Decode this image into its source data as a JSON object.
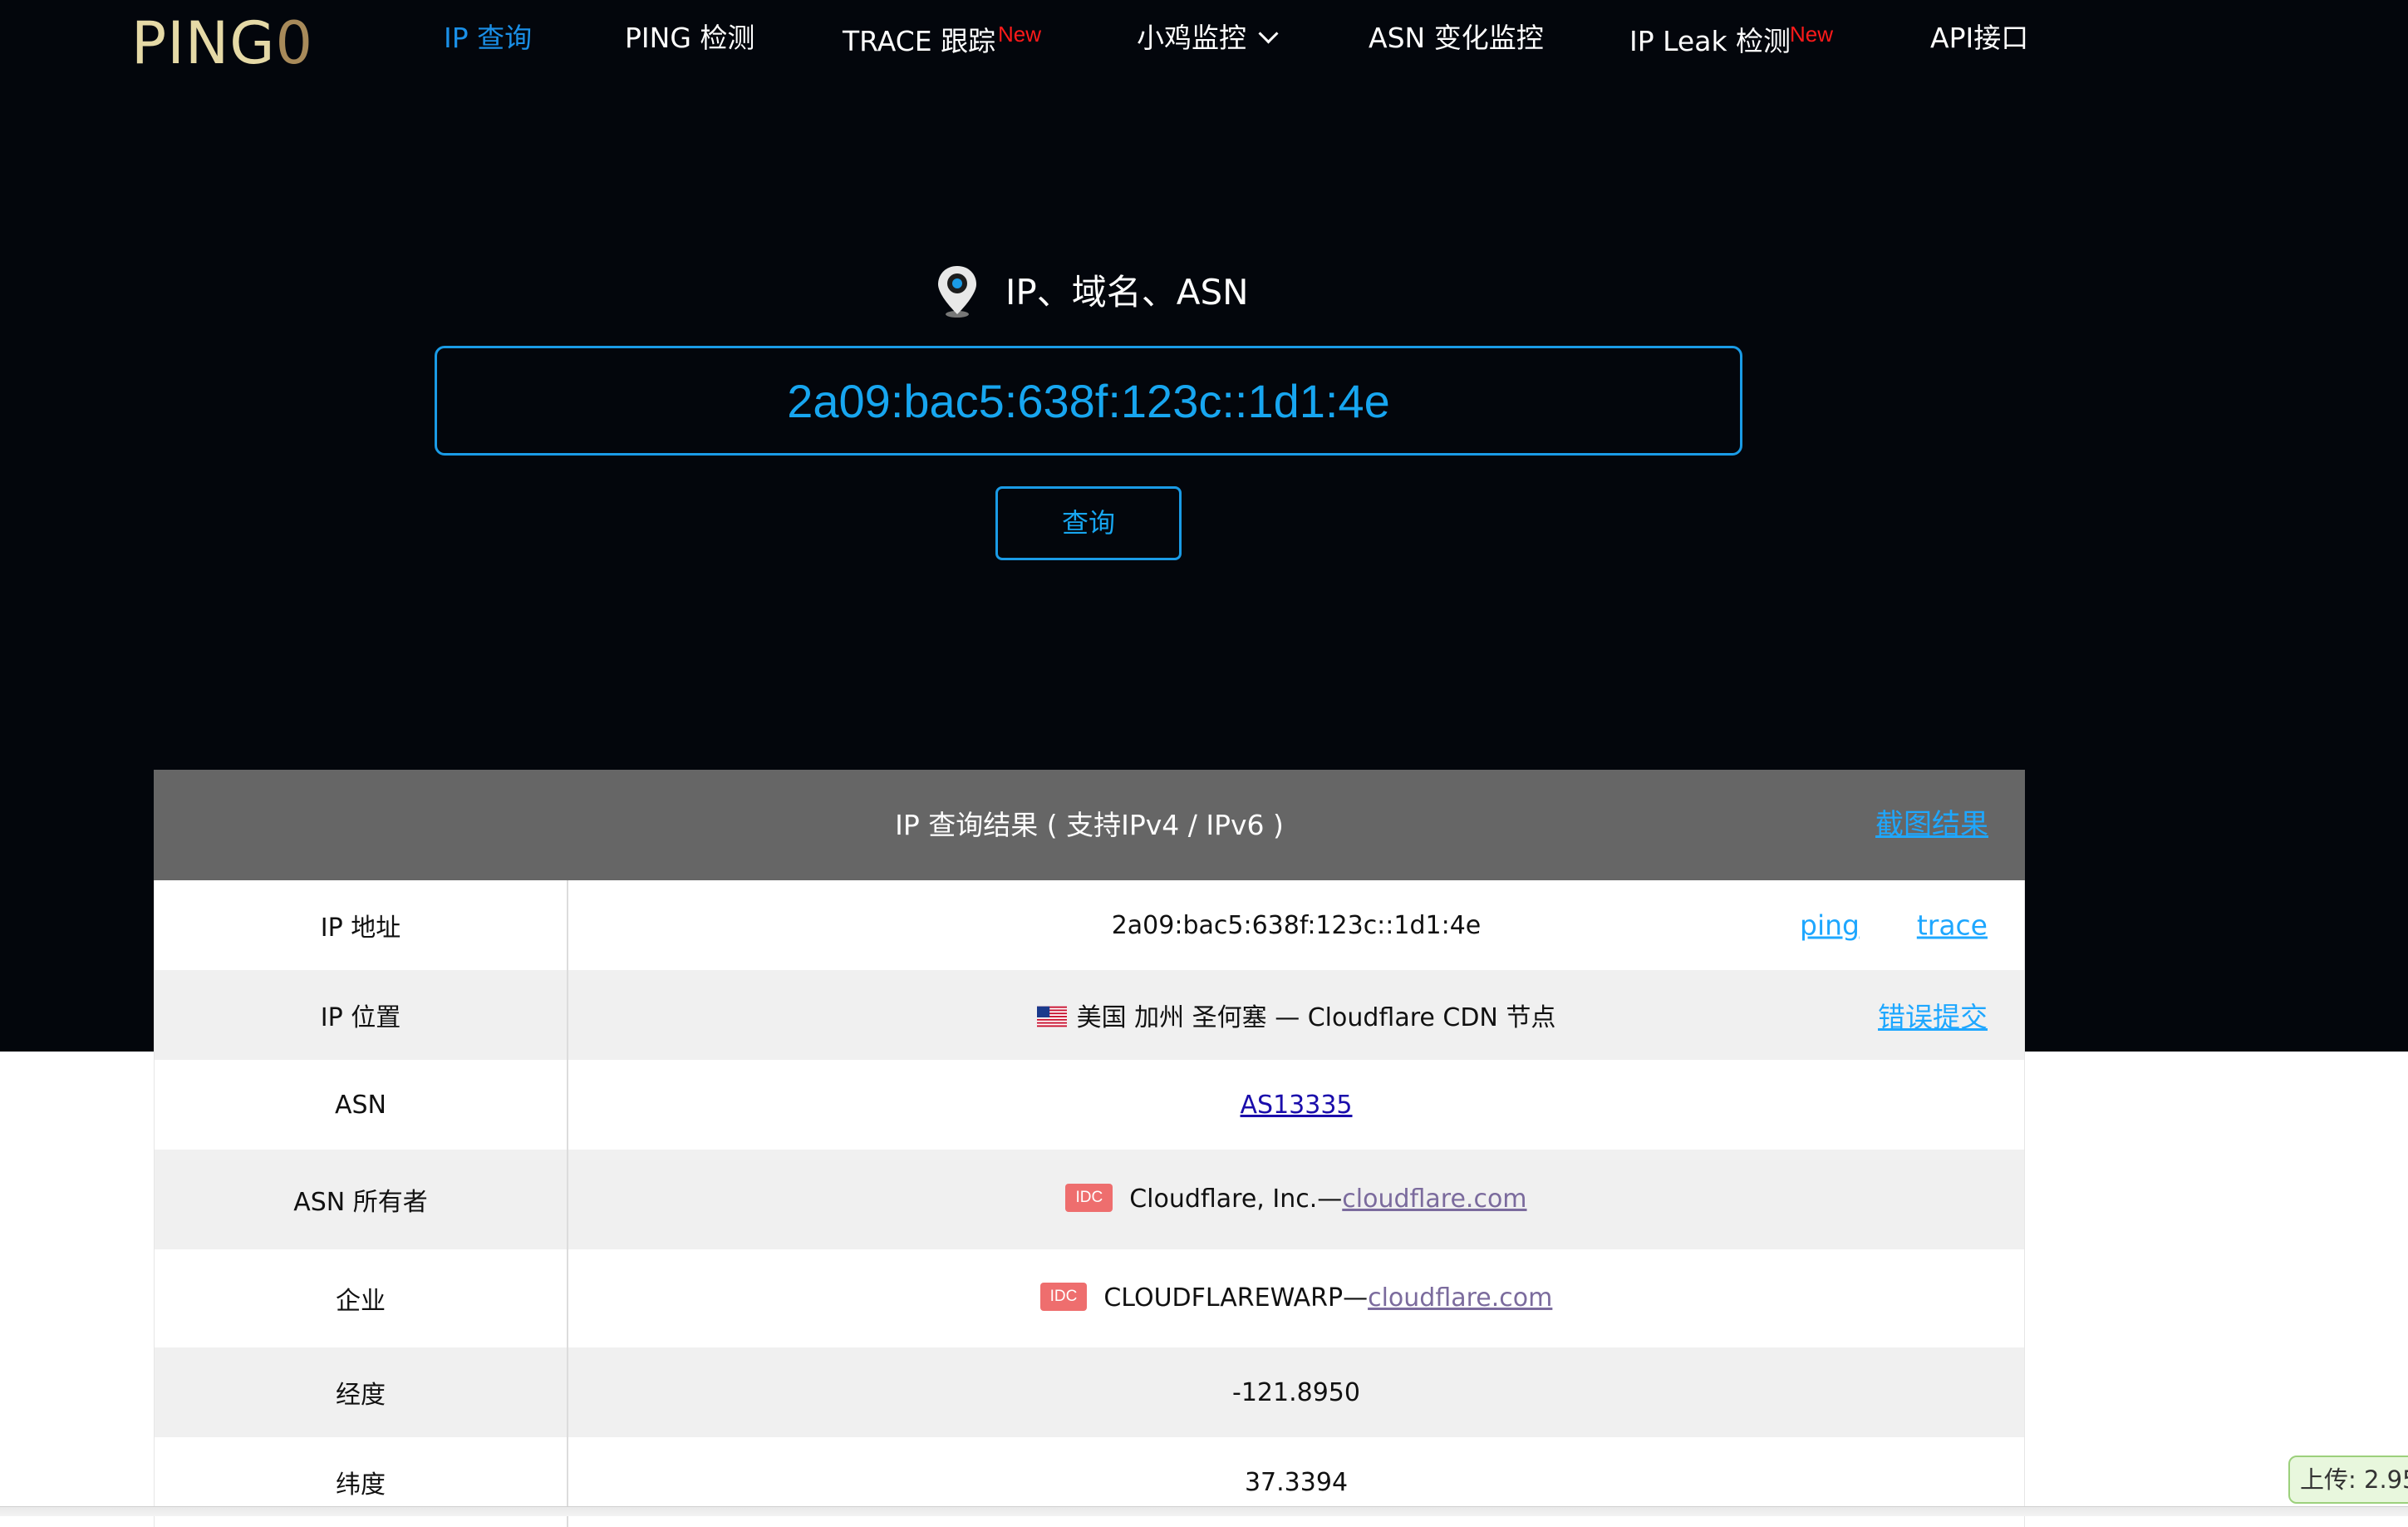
{
  "nav": {
    "logo_main": "PING",
    "logo_zero": "0",
    "items": [
      {
        "label": "IP 查询"
      },
      {
        "label": "PING 检测"
      },
      {
        "label": "TRACE 跟踪",
        "badge": "New"
      },
      {
        "label": "小鸡监控"
      },
      {
        "label": "ASN 变化监控"
      },
      {
        "label": "IP Leak 检测",
        "badge": "New"
      },
      {
        "label": "API接口"
      }
    ]
  },
  "search": {
    "label": "IP、域名、ASN",
    "value": "2a09:bac5:638f:123c::1d1:4e",
    "button": "查询"
  },
  "results": {
    "title": "IP 查询结果 ( 支持IPv4 / IPv6 )",
    "screenshot_link": "截图结果",
    "rows": [
      {
        "key": "IP 地址",
        "value": "2a09:bac5:638f:123c::1d1:4e",
        "links": [
          "ping",
          "trace"
        ]
      },
      {
        "key": "IP 位置",
        "value": "美国 加州 圣何塞 — Cloudflare CDN 节点",
        "links": [
          "错误提交"
        ]
      },
      {
        "key": "ASN",
        "value": "AS13335"
      },
      {
        "key": "ASN 所有者",
        "badge": "IDC",
        "value": "Cloudflare, Inc.—",
        "site": "cloudflare.com"
      },
      {
        "key": "企业",
        "badge": "IDC",
        "value": "CLOUDFLAREWARP—",
        "site": "cloudflare.com"
      },
      {
        "key": "经度",
        "value": "-121.8950"
      },
      {
        "key": "纬度",
        "value": "37.3394"
      }
    ]
  },
  "upload": {
    "text": "上传: 2.95"
  },
  "colors": {
    "accent": "#1a9be6",
    "hero_bg": "#03060c",
    "new_badge": "#ff1a1a",
    "idc_badge": "#ee6e6e",
    "header_gray": "#666666"
  }
}
